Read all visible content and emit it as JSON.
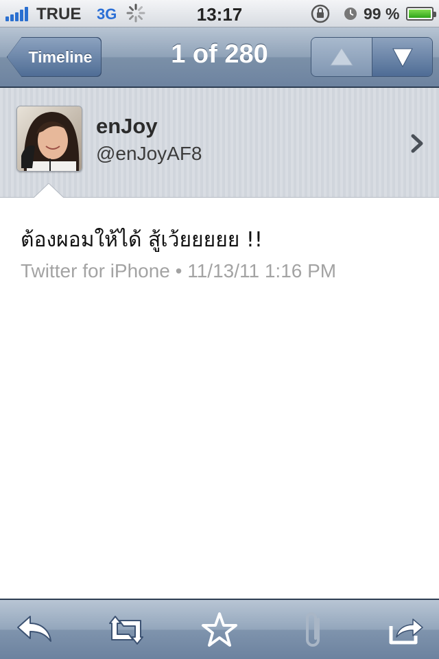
{
  "status_bar": {
    "carrier": "TRUE",
    "network": "3G",
    "time": "13:17",
    "battery_percent": "99 %",
    "battery_level": 0.99,
    "signal_bars": 5,
    "icons": [
      "signal-icon",
      "activity-spinner-icon",
      "rotation-lock-icon",
      "alarm-icon",
      "battery-icon"
    ]
  },
  "nav": {
    "back_label": "Timeline",
    "title": "1 of 280",
    "previous_icon": "up-arrow-icon",
    "next_icon": "down-arrow-icon"
  },
  "profile": {
    "name": "enJoy",
    "handle": "@enJoyAF8",
    "disclosure_icon": "chevron-right-icon"
  },
  "tweet": {
    "text": "ต้องผอมให้ได้ สู้เว้ยยยยย !!",
    "meta": "Twitter for iPhone • 11/13/11 1:16 PM"
  },
  "toolbar": {
    "items": [
      {
        "name": "reply",
        "icon": "reply-icon",
        "enabled": true
      },
      {
        "name": "retweet",
        "icon": "retweet-icon",
        "enabled": true
      },
      {
        "name": "favorite",
        "icon": "star-icon",
        "enabled": true
      },
      {
        "name": "attach",
        "icon": "paperclip-icon",
        "enabled": false
      },
      {
        "name": "share",
        "icon": "share-icon",
        "enabled": true
      }
    ]
  },
  "colors": {
    "nav_blue": "#7b90a8",
    "network_blue": "#2b6fd6",
    "battery_green": "#2fa51a",
    "meta_gray": "#a3a3a3"
  }
}
